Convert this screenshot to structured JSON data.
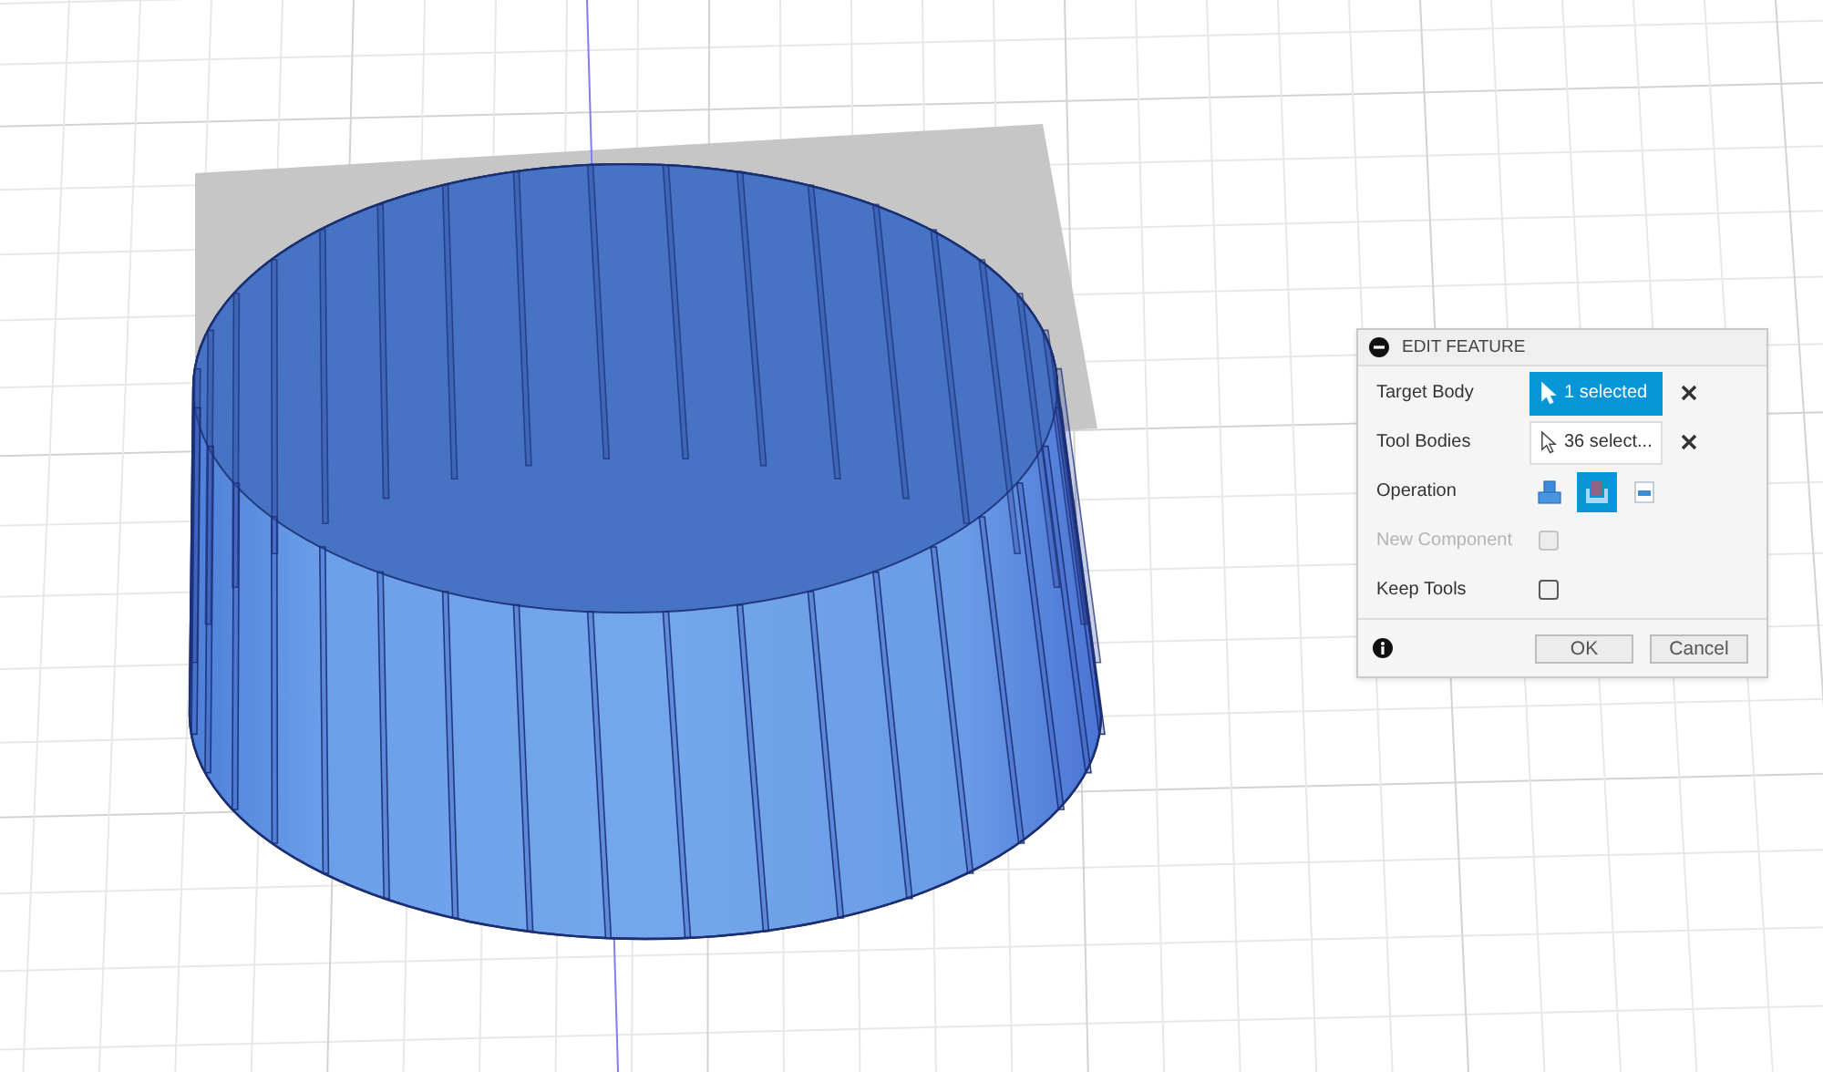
{
  "dialog": {
    "title": "EDIT FEATURE",
    "rows": [
      {
        "kind": "selection",
        "label": "Target Body",
        "value": "1 selected",
        "active": true
      },
      {
        "kind": "selection",
        "label": "Tool Bodies",
        "value": "36 select...",
        "active": false
      },
      {
        "kind": "operation",
        "label": "Operation",
        "options": [
          {
            "kind": "join",
            "selected": false
          },
          {
            "kind": "cut",
            "selected": true
          },
          {
            "kind": "intersect",
            "selected": false
          }
        ]
      },
      {
        "kind": "checkbox",
        "label": "New Component",
        "checked": false,
        "disabled": true
      },
      {
        "kind": "checkbox",
        "label": "Keep Tools",
        "checked": false,
        "disabled": false
      }
    ],
    "buttons": [
      "OK",
      "Cancel"
    ]
  }
}
